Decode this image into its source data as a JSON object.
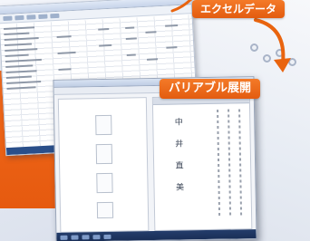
{
  "labels": {
    "excel_data": "エクセルデータ",
    "variable_expand": "バリアブル展開"
  },
  "form_preview": {
    "vertical_text": [
      "中",
      "井",
      "直",
      "美"
    ]
  },
  "colors": {
    "accent_orange": "#e9640f",
    "label_text": "#ffffff"
  },
  "icons": {
    "flow_arrow": "curved-arrow-icon"
  }
}
